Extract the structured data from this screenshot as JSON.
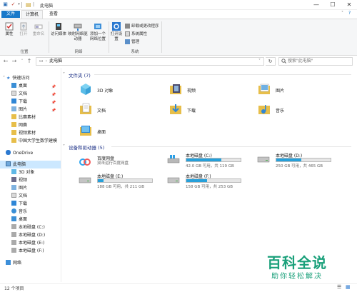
{
  "window": {
    "path_title": "此电脑",
    "minimize": "—",
    "maximize": "☐",
    "close": "✕"
  },
  "tabs": {
    "file": "文件",
    "computer": "计算机",
    "view": "查看"
  },
  "ribbon": {
    "location_group": "位置",
    "network_group": "网络",
    "system_group": "系统",
    "properties": "属性",
    "open": "打开",
    "rename": "重命名",
    "access_media": "访问媒体",
    "map_drive": "映射网络驱动器",
    "add_location": "添加一个网络位置",
    "open_settings": "打开设置",
    "uninstall": "卸载或更改程序",
    "system_properties": "系统属性",
    "manage": "管理"
  },
  "address": {
    "path": "此电脑",
    "search_placeholder": "搜索\"此电脑\""
  },
  "nav": {
    "quick_access": "快速访问",
    "items": [
      "桌面",
      "文档",
      "下载",
      "图片",
      "比赛素材",
      "网赛",
      "视频素材",
      "中国大学生数学建模"
    ],
    "onedrive": "OneDrive",
    "this_pc": "此电脑",
    "pc_items": [
      "3D 对象",
      "视频",
      "图片",
      "文档",
      "下载",
      "音乐",
      "桌面",
      "本地磁盘 (C:)",
      "本地磁盘 (D:)",
      "本地磁盘 (E:)",
      "本地磁盘 (F:)"
    ],
    "network": "网络"
  },
  "folders_section": "文件夹 (7)",
  "folders": [
    {
      "name": "3D 对象"
    },
    {
      "name": "视频"
    },
    {
      "name": "图片"
    },
    {
      "name": "文档"
    },
    {
      "name": "下载"
    },
    {
      "name": "音乐"
    },
    {
      "name": "桌面"
    }
  ],
  "devices_section": "设备和驱动器 (5)",
  "baidu": {
    "name": "百度网盘",
    "desc": "双击运行百度网盘"
  },
  "drives": [
    {
      "name": "本地磁盘 (C:)",
      "info": "42.0 GB 可用，共 119 GB",
      "used": 0.65
    },
    {
      "name": "本地磁盘 (D:)",
      "info": "250 GB 可用，共 465 GB",
      "used": 0.46
    },
    {
      "name": "本地磁盘 (E:)",
      "info": "188 GB 可用，共 211 GB",
      "used": 0.11
    },
    {
      "name": "本地磁盘 (F:)",
      "info": "158 GB 可用，共 253 GB",
      "used": 0.38
    }
  ],
  "status": "12 个项目",
  "watermark": {
    "logo": "百科全说",
    "sub": "助你轻松解决"
  }
}
